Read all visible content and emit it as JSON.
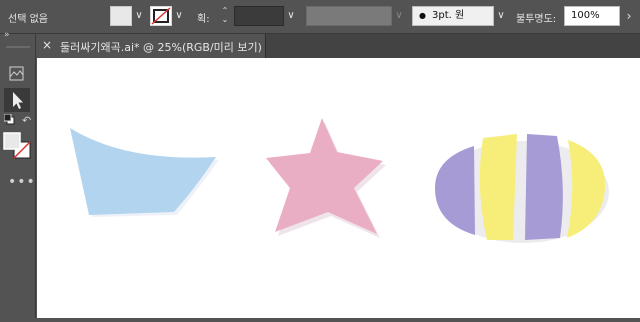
{
  "control_bar": {
    "selection_label": "선택 없음",
    "stroke_label": "획:",
    "brush_value": "3pt. 원",
    "opacity_label": "불투명도:",
    "opacity_value": "100%"
  },
  "document_tab": {
    "title": "둘러싸기왜곡.ai* @ 25%(RGB/미리 보기)"
  },
  "toolbar": {
    "more_tools": "•••"
  },
  "colors": {
    "wave_fill": "#b3d4ef",
    "star_fill": "#eaaec4",
    "ellipse_purple": "#a79bd6",
    "ellipse_yellow": "#f6ee78",
    "shadow": "#e9e9ec"
  }
}
